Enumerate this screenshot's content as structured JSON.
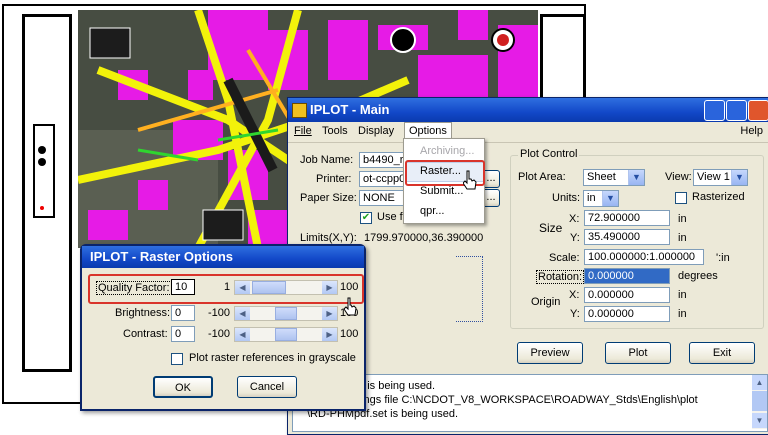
{
  "main_window": {
    "title": "IPLOT - Main",
    "menu": {
      "file": "File",
      "tools": "Tools",
      "display": "Display",
      "options": "Options",
      "help": "Help"
    },
    "job_name_label": "Job Name:",
    "job_name_value": "b4490_rc",
    "printer_label": "Printer:",
    "printer_value": "ot-ccpp01",
    "paper_size_label": "Paper Size:",
    "paper_size_value": "NONE",
    "browse_label": "...",
    "use_full_paper_label": "Use full paper size",
    "use_full_paper_checked": true,
    "limits_label": "Limits(X,Y):",
    "limits_value": "1799.970000,36.390000",
    "plot_control": {
      "title": "Plot Control",
      "plot_area_label": "Plot Area:",
      "plot_area_value": "Sheet",
      "view_label": "View:",
      "view_value": "View 1",
      "units_label": "Units:",
      "units_value": "in",
      "rasterized_label": "Rasterized",
      "size_label": "Size",
      "x_label": "X:",
      "y_label": "Y:",
      "size_x": "72.900000",
      "size_y": "35.490000",
      "size_unit": "in",
      "scale_label": "Scale:",
      "scale_value": "100.000000:1.000000",
      "scale_unit": "':in",
      "rotation_label": "Rotation:",
      "rotation_value": "0.000000",
      "rotation_unit": "degrees",
      "origin_label": "Origin",
      "origin_x": "0.000000",
      "origin_y": "0.000000",
      "origin_unit": "in"
    },
    "buttons": {
      "preview": "Preview",
      "plot": "Plot",
      "exit": "Exit"
    },
    "log_lines": [
      "et is being used.",
      "ttings file C:\\NCDOT_V8_WORKSPACE\\ROADWAY_Stds\\English\\plot",
      "\\RD-PHMpdf.set is being used."
    ]
  },
  "options_menu": {
    "items": [
      "Archiving...",
      "Raster...",
      "Submit...",
      "qpr..."
    ],
    "disabled_index": 0,
    "highlighted_index": 1
  },
  "raster_window": {
    "title": "IPLOT - Raster Options",
    "quality_label": "Quality Factor:",
    "quality_value": "10",
    "quality_min": "1",
    "quality_max": "100",
    "brightness_label": "Brightness:",
    "brightness_value": "0",
    "brightness_min": "-100",
    "brightness_max": "100",
    "contrast_label": "Contrast:",
    "contrast_value": "0",
    "contrast_min": "-100",
    "contrast_max": "100",
    "grayscale_label": "Plot raster references in grayscale",
    "grayscale_checked": false,
    "ok_label": "OK",
    "cancel_label": "Cancel"
  },
  "colors": {
    "titlebar": "#1248c8",
    "highlight_box": "#d9342b",
    "menu_highlight": "#316ac5",
    "map_magenta": "#e61be6",
    "map_yellow": "#f2f20a"
  }
}
